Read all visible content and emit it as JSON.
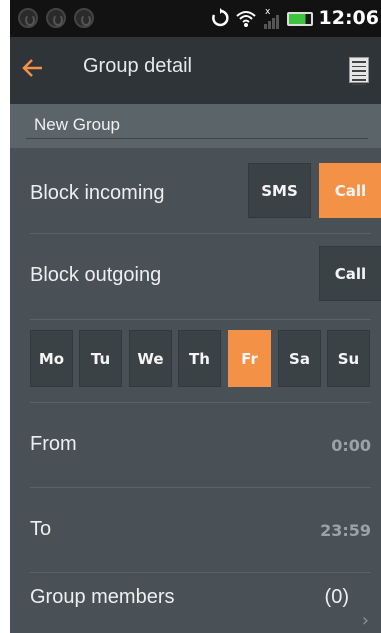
{
  "status_bar": {
    "time": "12:06",
    "icons": [
      "sync-icon",
      "wifi-icon",
      "signal-icon",
      "battery-icon"
    ]
  },
  "header": {
    "title": "Group detail"
  },
  "group_name": {
    "value": "New Group"
  },
  "block_incoming": {
    "label": "Block incoming",
    "sms_label": "SMS",
    "call_label": "Call",
    "call_active": true
  },
  "block_outgoing": {
    "label": "Block outgoing",
    "call_label": "Call"
  },
  "days": [
    {
      "label": "Mo",
      "active": false
    },
    {
      "label": "Tu",
      "active": false
    },
    {
      "label": "We",
      "active": false
    },
    {
      "label": "Th",
      "active": false
    },
    {
      "label": "Fr",
      "active": true
    },
    {
      "label": "Sa",
      "active": false
    },
    {
      "label": "Su",
      "active": false
    }
  ],
  "from": {
    "label": "From",
    "value": "0:00"
  },
  "to": {
    "label": "To",
    "value": "23:59"
  },
  "members": {
    "label": "Group members",
    "count": "(0)"
  },
  "colors": {
    "accent": "#f39146",
    "background": "#4a5156",
    "header": "#2f3438"
  }
}
